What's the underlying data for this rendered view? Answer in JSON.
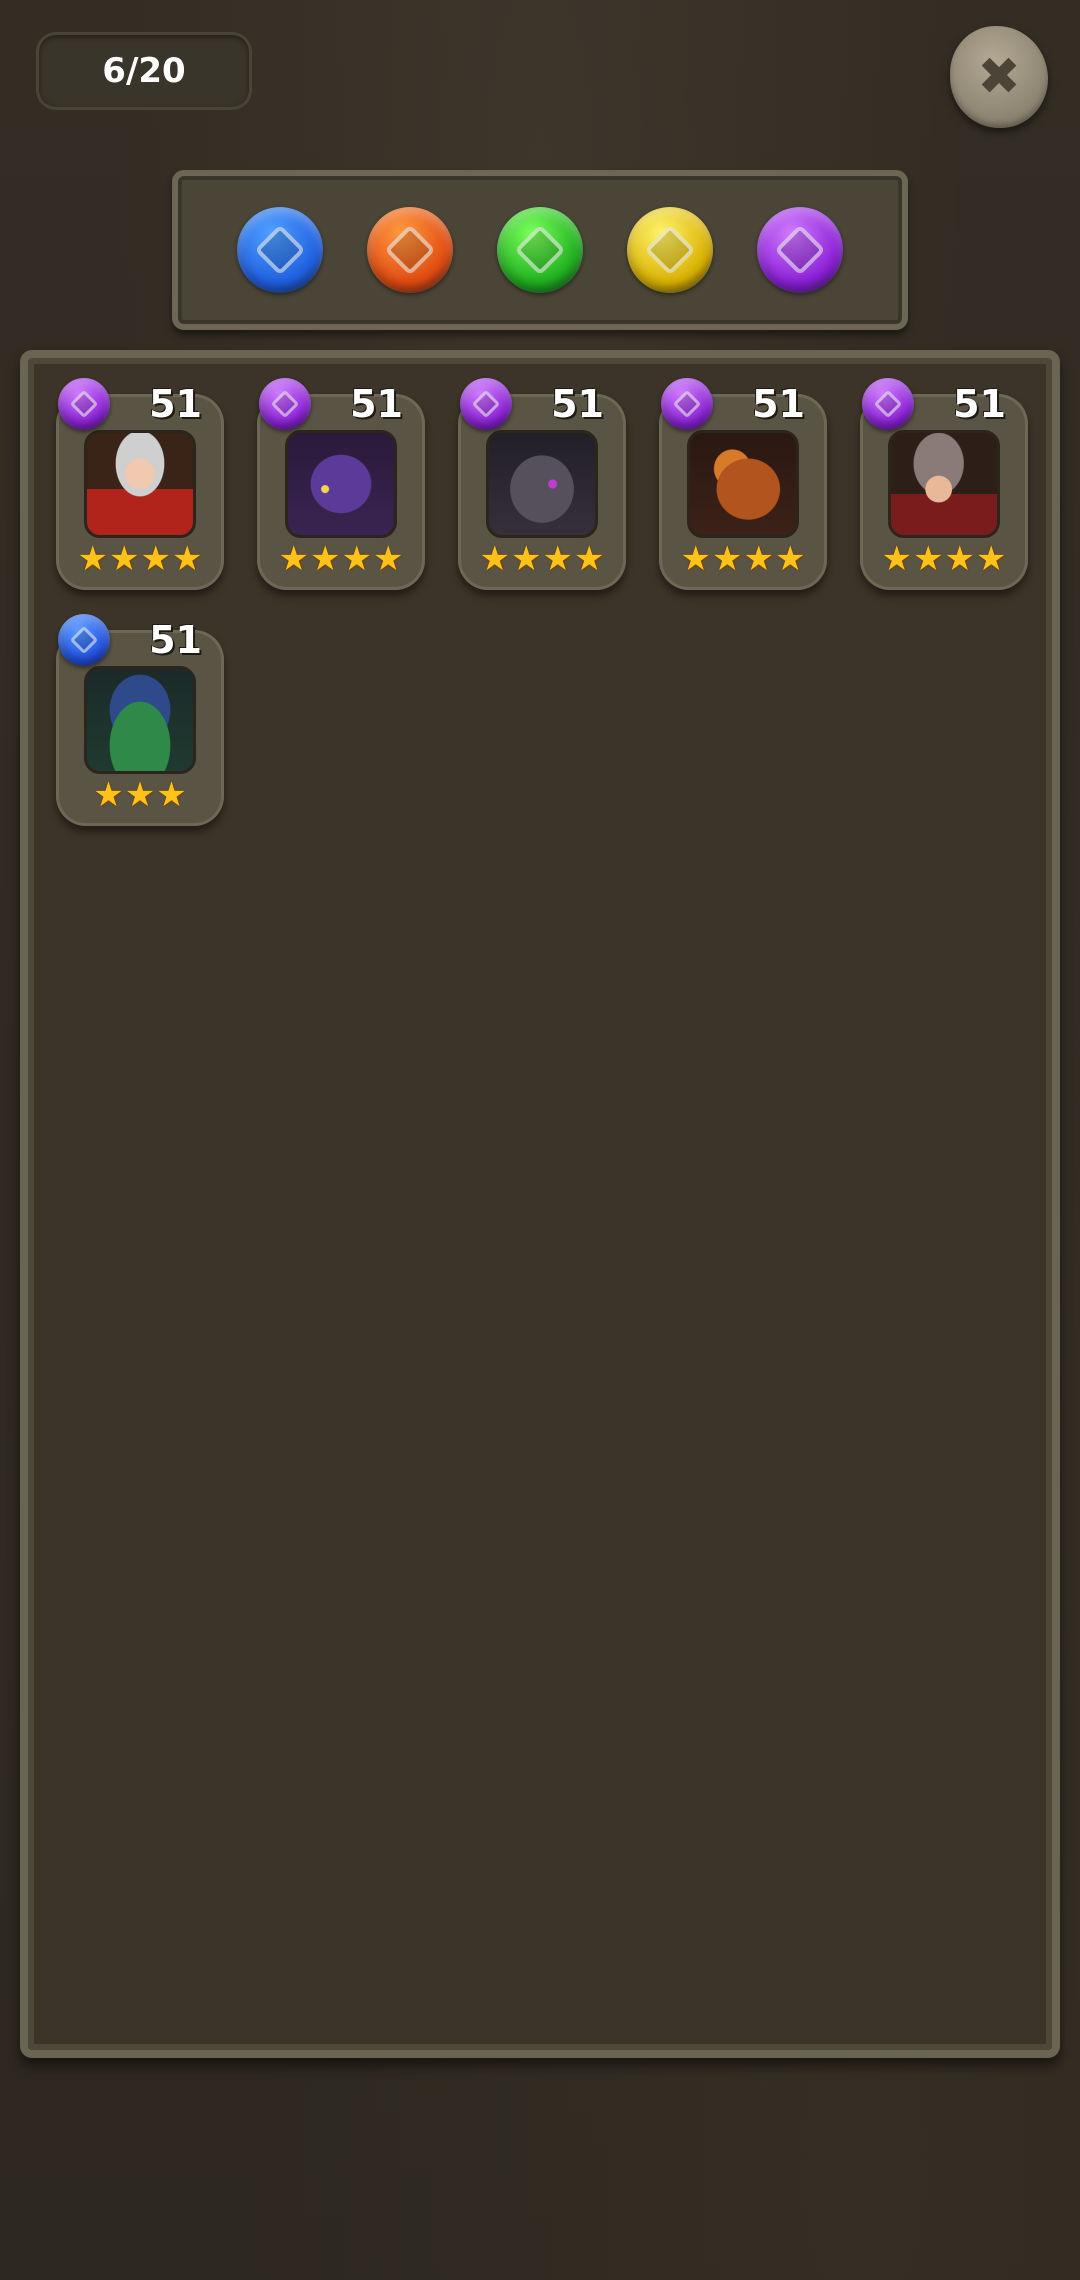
{
  "counter": "6/20",
  "filters": [
    {
      "name": "blue-element-filter",
      "color": "#1f5fe0",
      "light": "#4fa0ff"
    },
    {
      "name": "fire-element-filter",
      "color": "#e04a10",
      "light": "#ff9a40"
    },
    {
      "name": "wood-element-filter",
      "color": "#1fae1f",
      "light": "#7aff5a"
    },
    {
      "name": "light-element-filter",
      "color": "#d9b000",
      "light": "#fff36a"
    },
    {
      "name": "dark-element-filter",
      "color": "#8a1fd6",
      "light": "#d07aff"
    }
  ],
  "heroes": [
    {
      "level": "51",
      "element": "dark",
      "stars": 4,
      "portrait": "horned-woman-portrait"
    },
    {
      "level": "51",
      "element": "dark",
      "stars": 4,
      "portrait": "purple-dragon-portrait"
    },
    {
      "level": "51",
      "element": "dark",
      "stars": 4,
      "portrait": "dark-bone-dragon-portrait"
    },
    {
      "level": "51",
      "element": "dark",
      "stars": 4,
      "portrait": "red-dragon-portrait"
    },
    {
      "level": "51",
      "element": "dark",
      "stars": 4,
      "portrait": "spiky-haired-warrior-portrait"
    },
    {
      "level": "51",
      "element": "blue",
      "stars": 3,
      "portrait": "green-slime-monster-portrait"
    }
  ],
  "element_colors": {
    "dark": {
      "color": "#8a1fd6",
      "light": "#d07aff"
    },
    "blue": {
      "color": "#1f4fe0",
      "light": "#5a9cff"
    }
  }
}
